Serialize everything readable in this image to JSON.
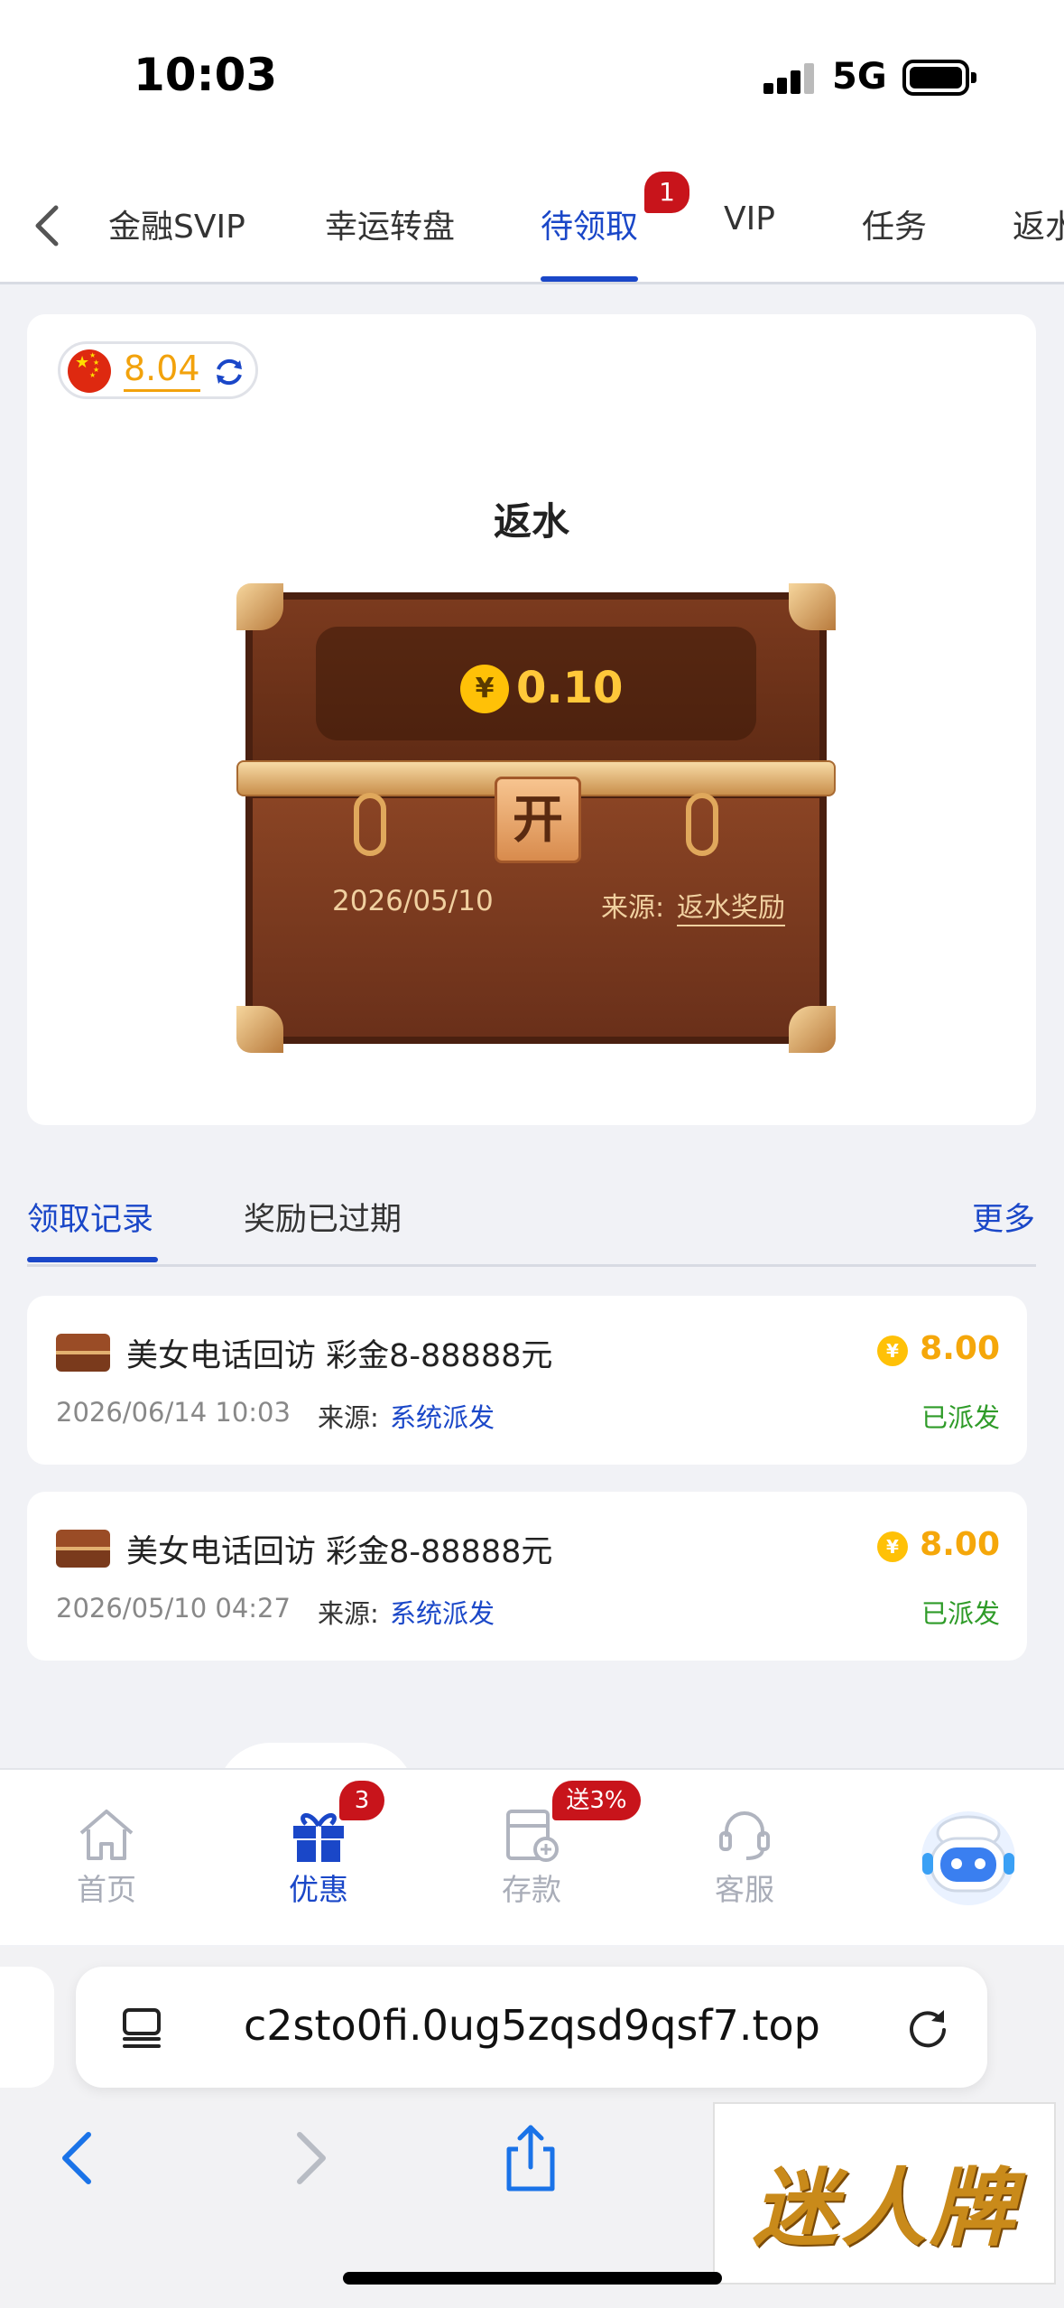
{
  "status_bar": {
    "time": "10:03",
    "network": "5G"
  },
  "top_tabs": {
    "items": [
      {
        "label": "金融SVIP"
      },
      {
        "label": "幸运转盘"
      },
      {
        "label": "待领取"
      },
      {
        "label": "VIP"
      },
      {
        "label": "任务"
      },
      {
        "label": "返水"
      }
    ],
    "active_badge": "1"
  },
  "card": {
    "balance": "8.04",
    "title": "返水",
    "chest": {
      "coin_symbol": "¥",
      "amount": "0.10",
      "lock_label": "开",
      "date": "2026/05/10",
      "source_label": "来源:",
      "source_value": "返水奖励"
    }
  },
  "record_tabs": {
    "items": [
      {
        "label": "领取记录"
      },
      {
        "label": "奖励已过期"
      }
    ],
    "more": "更多"
  },
  "records": [
    {
      "title": "美女电话回访 彩金8-88888元",
      "amount": "8.00",
      "time": "2026/06/14 10:03",
      "source_label": "来源:",
      "source_value": "系统派发",
      "status": "已派发"
    },
    {
      "title": "美女电话回访 彩金8-88888元",
      "amount": "8.00",
      "time": "2026/05/10 04:27",
      "source_label": "来源:",
      "source_value": "系统派发",
      "status": "已派发"
    }
  ],
  "bottom_nav": {
    "items": [
      {
        "label": "首页",
        "icon": "home-icon"
      },
      {
        "label": "优惠",
        "icon": "gift-icon",
        "badge": "3"
      },
      {
        "label": "存款",
        "icon": "deposit-icon",
        "badge": "送3%"
      },
      {
        "label": "客服",
        "icon": "headset-icon"
      }
    ]
  },
  "browser": {
    "url": "c2sto0fi.0ug5zqsd9qsf7.top"
  },
  "watermark": {
    "text": "迷人牌"
  },
  "colors": {
    "accent": "#1a47c8",
    "gold": "#f5a70a",
    "success": "#2e9b28",
    "badge": "#c8141b"
  }
}
